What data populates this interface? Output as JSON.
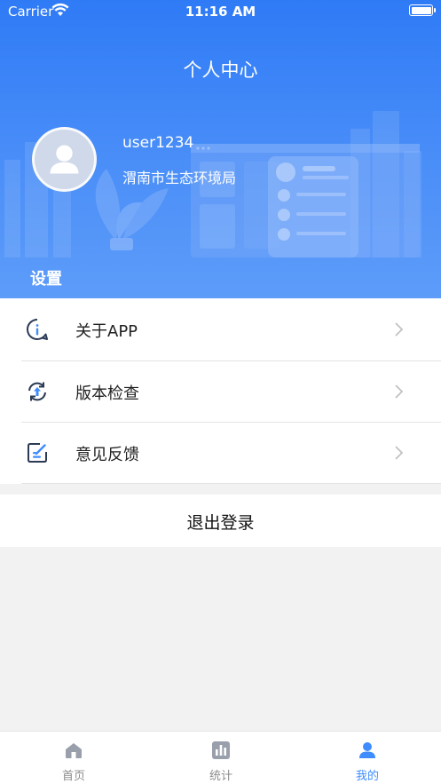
{
  "status_bar": {
    "carrier": "Carrier",
    "time": "11:16 AM"
  },
  "header": {
    "title": "个人中心"
  },
  "profile": {
    "username": "user1234",
    "organization": "渭南市生态环境局"
  },
  "settings": {
    "section_title": "设置",
    "items": [
      {
        "label": "关于APP",
        "icon": "info-icon"
      },
      {
        "label": "版本检查",
        "icon": "update-icon"
      },
      {
        "label": "意见反馈",
        "icon": "feedback-icon"
      }
    ]
  },
  "logout": {
    "label": "退出登录"
  },
  "tabbar": {
    "items": [
      {
        "label": "首页",
        "icon": "home-icon",
        "active": false
      },
      {
        "label": "统计",
        "icon": "stats-icon",
        "active": false
      },
      {
        "label": "我的",
        "icon": "user-icon",
        "active": true
      }
    ]
  },
  "colors": {
    "accent": "#3f8cff",
    "header_top": "#2f7bf6",
    "header_bottom": "#5d9cf9"
  }
}
